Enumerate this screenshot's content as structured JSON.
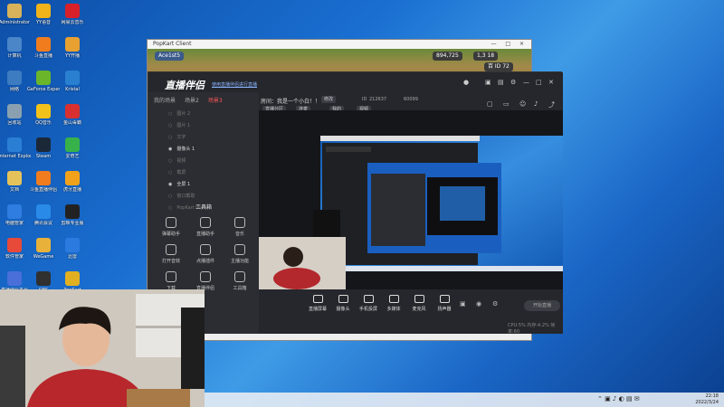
{
  "desktop": {
    "col1": [
      {
        "label": "Administrator",
        "icon": "user-folder-icon",
        "color": "#d8b25a"
      },
      {
        "label": "计算机",
        "icon": "computer-icon",
        "color": "#4a86c8"
      },
      {
        "label": "网络",
        "icon": "network-icon",
        "color": "#3d7cc0"
      },
      {
        "label": "回收站",
        "icon": "recycle-bin-icon",
        "color": "#8aa0b0"
      },
      {
        "label": "Internet Explorer",
        "icon": "ie-icon",
        "color": "#2a7fd4"
      },
      {
        "label": "文档",
        "icon": "folder-icon",
        "color": "#e6c35a"
      },
      {
        "label": "电脑管家",
        "icon": "pc-manager-icon",
        "color": "#2f7de0"
      },
      {
        "label": "软件管家",
        "icon": "software-manager-icon",
        "color": "#e84a3a"
      },
      {
        "label": "直播伴侣平台",
        "icon": "app-icon",
        "color": "#4a6fd8"
      }
    ],
    "col2": [
      {
        "label": "YY语音",
        "icon": "yy-icon",
        "color": "#f2b21a"
      },
      {
        "label": "斗鱼直播",
        "icon": "douyu-icon",
        "color": "#f07c1e"
      },
      {
        "label": "GeForce Experience",
        "icon": "nvidia-icon",
        "color": "#6bb52a"
      },
      {
        "label": "QQ音乐",
        "icon": "music-icon",
        "color": "#f2c21a"
      },
      {
        "label": "Steam",
        "icon": "steam-icon",
        "color": "#1b2838"
      },
      {
        "label": "斗鱼直播伴侣",
        "icon": "douyu-icon",
        "color": "#f07c1e"
      },
      {
        "label": "腾讯会议",
        "icon": "meeting-icon",
        "color": "#2a8ae8"
      },
      {
        "label": "WeGame",
        "icon": "wegame-icon",
        "color": "#e8b23a"
      },
      {
        "label": "OBS",
        "icon": "obs-icon",
        "color": "#303030"
      }
    ],
    "col3": [
      {
        "label": "网易云音乐",
        "icon": "netease-music-icon",
        "color": "#d8202a"
      },
      {
        "label": "YY开播",
        "icon": "app-icon",
        "color": "#e8a030"
      },
      {
        "label": "Kristal",
        "icon": "app-icon",
        "color": "#2a80d0"
      },
      {
        "label": "金山毒霸",
        "icon": "antivirus-icon",
        "color": "#d83030"
      },
      {
        "label": "爱奇艺",
        "icon": "iqiyi-icon",
        "color": "#37b24a"
      },
      {
        "label": "虎牙直播",
        "icon": "huya-icon",
        "color": "#f2a21a"
      },
      {
        "label": "剪映专业版",
        "icon": "editor-icon",
        "color": "#222"
      },
      {
        "label": "迅雷",
        "icon": "thunder-icon",
        "color": "#2a7ae0"
      },
      {
        "label": "PopKart",
        "icon": "game-icon",
        "color": "#e0b020"
      }
    ]
  },
  "game": {
    "title": "PopKart Client",
    "controls": "— □ ×",
    "chips": [
      {
        "text": "Ace1st5",
        "color": "#3a5a8a"
      },
      {
        "text": "894,725",
        "color": "#3a3a3a"
      },
      {
        "text": "1,3 18",
        "color": "#3a3a3a"
      },
      {
        "text": "百 ID 72",
        "color": "#3a3a3a"
      }
    ]
  },
  "app": {
    "logo": "直播伴侣",
    "notice": "使用直播伴侣进行直播",
    "room_title": "房间：我是一个小白！！",
    "room_tag": "修改",
    "tags": [
      "直播分区",
      "连麦",
      "我的",
      "视频"
    ],
    "room_id": "212637",
    "room_id_label": "ID",
    "fans": "60099",
    "left_tabs": [
      {
        "label": "我的场景",
        "active": false
      },
      {
        "label": "场景2",
        "active": false
      },
      {
        "label": "场景3",
        "active": true
      }
    ],
    "sources": [
      {
        "label": "图片 2",
        "visible": false
      },
      {
        "label": "图片 1",
        "visible": false
      },
      {
        "label": "文字",
        "visible": false
      },
      {
        "label": "摄像头 1",
        "visible": true
      },
      {
        "label": "视频",
        "visible": false
      },
      {
        "label": "截屏",
        "visible": false
      },
      {
        "label": "全屏 1",
        "visible": true
      },
      {
        "label": "窗口截取",
        "visible": false
      },
      {
        "label": "PopKart Client",
        "visible": false
      }
    ],
    "tools_title": "工具箱",
    "tools": [
      "弹幕助手",
      "直播助手",
      "音乐",
      "打开音效",
      "点播插件",
      "主播功能",
      "下载",
      "直播伴侣",
      "工具箱"
    ],
    "bottom": [
      "直播屏幕",
      "摄像头",
      "手机投屏",
      "多媒体",
      "麦克风",
      "扬声器"
    ],
    "start_label": "开始直播",
    "stats": "CPU:5%  内存:4.2%  帧率:60"
  },
  "taskbar": {
    "time": "22:18",
    "date": "2022/3/24"
  }
}
